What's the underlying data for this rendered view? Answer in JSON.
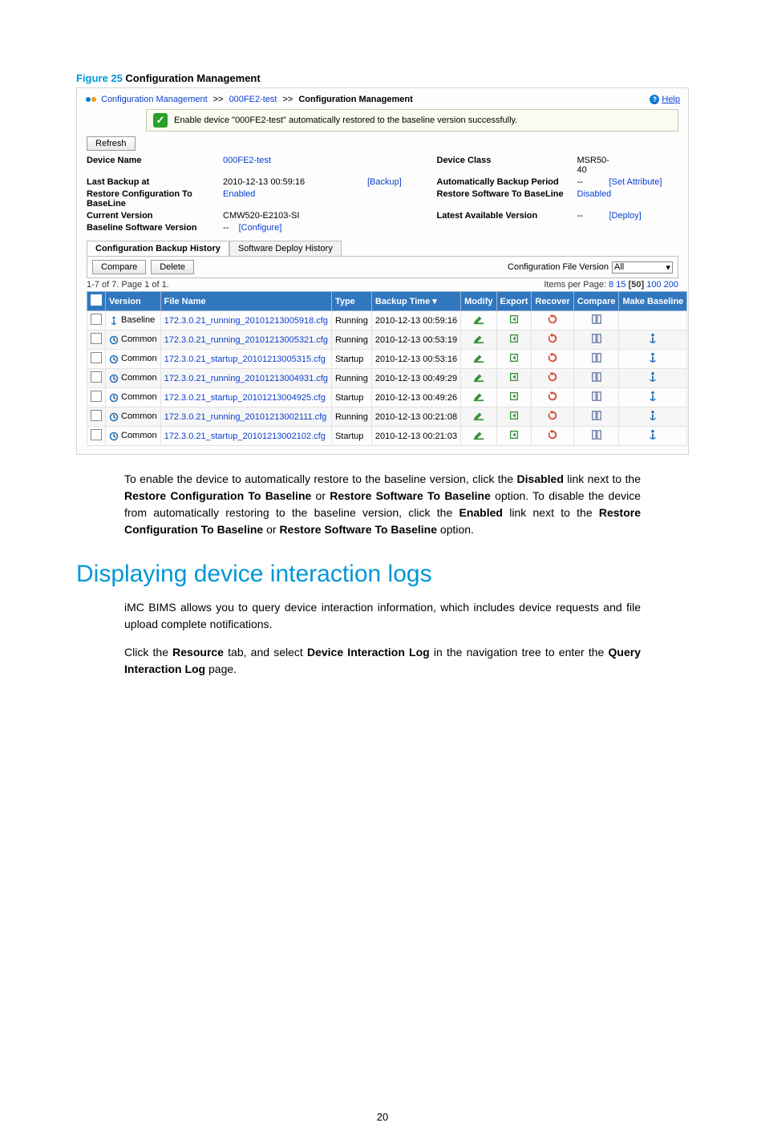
{
  "figure": {
    "num": "Figure 25",
    "title": "Configuration Management"
  },
  "breadcrumb": {
    "a": "Configuration Management",
    "b": "000FE2-test",
    "c": "Configuration Management",
    "help": "Help"
  },
  "msg": "Enable device \"000FE2-test\" automatically restored to the baseline version successfully.",
  "refresh": "Refresh",
  "details": {
    "r1c1l": "Device Name",
    "r1c1v": "000FE2-test",
    "r1c2l": "Device Class",
    "r1c2v": "MSR50-40",
    "r2c1l": "Last Backup at",
    "r2c1v": "2010-12-13 00:59:16",
    "r2c1a": "[Backup]",
    "r2c2l": "Automatically Backup Period",
    "r2c2v": "--",
    "r2c2a": "[Set Attribute]",
    "r3c1l": "Restore Configuration To BaseLine",
    "r3c1v": "Enabled",
    "r3c2l": "Restore Software To BaseLine",
    "r3c2v": "Disabled",
    "r4c1l": "Current Version",
    "r4c1v": "CMW520-E2103-SI",
    "r4c2l": "Latest Available Version",
    "r4c2v": "--",
    "r4c2a": "[Deploy]",
    "r5c1l": "Baseline Software Version",
    "r5c1v": "--",
    "r5c1a": "[Configure]"
  },
  "tabs": {
    "active": "Configuration Backup History",
    "inactive": "Software Deploy History"
  },
  "toolbar": {
    "compare": "Compare",
    "delete": "Delete",
    "cfv_label": "Configuration File Version",
    "cfv_value": "All"
  },
  "pager": {
    "left": "1-7 of 7. Page 1 of 1.",
    "ipp_label": "Items per Page:",
    "ipp": [
      "8",
      "15",
      "[50]",
      "100",
      "200"
    ]
  },
  "cols": {
    "chk": "",
    "version": "Version",
    "file": "File Name",
    "type": "Type",
    "btime": "Backup Time ▾",
    "modify": "Modify",
    "export": "Export",
    "recover": "Recover",
    "compare": "Compare",
    "mb": "Make Baseline"
  },
  "rows": [
    {
      "v": "Baseline",
      "vi": "anchor",
      "f": "172.3.0.21_running_20101213005918.cfg",
      "t": "Running",
      "bt": "2010-12-13 00:59:16",
      "mb": false
    },
    {
      "v": "Common",
      "vi": "clock",
      "f": "172.3.0.21_running_20101213005321.cfg",
      "t": "Running",
      "bt": "2010-12-13 00:53:19",
      "mb": true
    },
    {
      "v": "Common",
      "vi": "clock",
      "f": "172.3.0.21_startup_20101213005315.cfg",
      "t": "Startup",
      "bt": "2010-12-13 00:53:16",
      "mb": true
    },
    {
      "v": "Common",
      "vi": "clock",
      "f": "172.3.0.21_running_20101213004931.cfg",
      "t": "Running",
      "bt": "2010-12-13 00:49:29",
      "mb": true
    },
    {
      "v": "Common",
      "vi": "clock",
      "f": "172.3.0.21_startup_20101213004925.cfg",
      "t": "Startup",
      "bt": "2010-12-13 00:49:26",
      "mb": true
    },
    {
      "v": "Common",
      "vi": "clock",
      "f": "172.3.0.21_running_20101213002111.cfg",
      "t": "Running",
      "bt": "2010-12-13 00:21:08",
      "mb": true
    },
    {
      "v": "Common",
      "vi": "clock",
      "f": "172.3.0.21_startup_20101213002102.cfg",
      "t": "Startup",
      "bt": "2010-12-13 00:21:03",
      "mb": true
    }
  ],
  "body": {
    "p1a": "To enable the device to automatically restore to the baseline version, click the ",
    "p1b": "Disabled",
    "p1c": " link next to the ",
    "p1d": "Restore Configuration To Baseline",
    "p1e": " or ",
    "p1f": "Restore Software To Baseline",
    "p1g": " option. To disable the device from automatically restoring to the baseline version, click the ",
    "p1h": "Enabled",
    "p1i": " link next to the ",
    "p1j": "Restore Configuration To Baseline",
    "p1k": " or ",
    "p1l": "Restore Software To Baseline",
    "p1m": " option."
  },
  "h1": "Displaying device interaction logs",
  "body2": {
    "p2": "iMC BIMS allows you to query device interaction information, which includes device requests and file upload complete notifications.",
    "p3a": "Click the ",
    "p3b": "Resource",
    "p3c": " tab, and select ",
    "p3d": "Device Interaction Log",
    "p3e": " in the navigation tree to enter the ",
    "p3f": "Query Interaction Log",
    "p3g": " page."
  },
  "page_num": "20"
}
